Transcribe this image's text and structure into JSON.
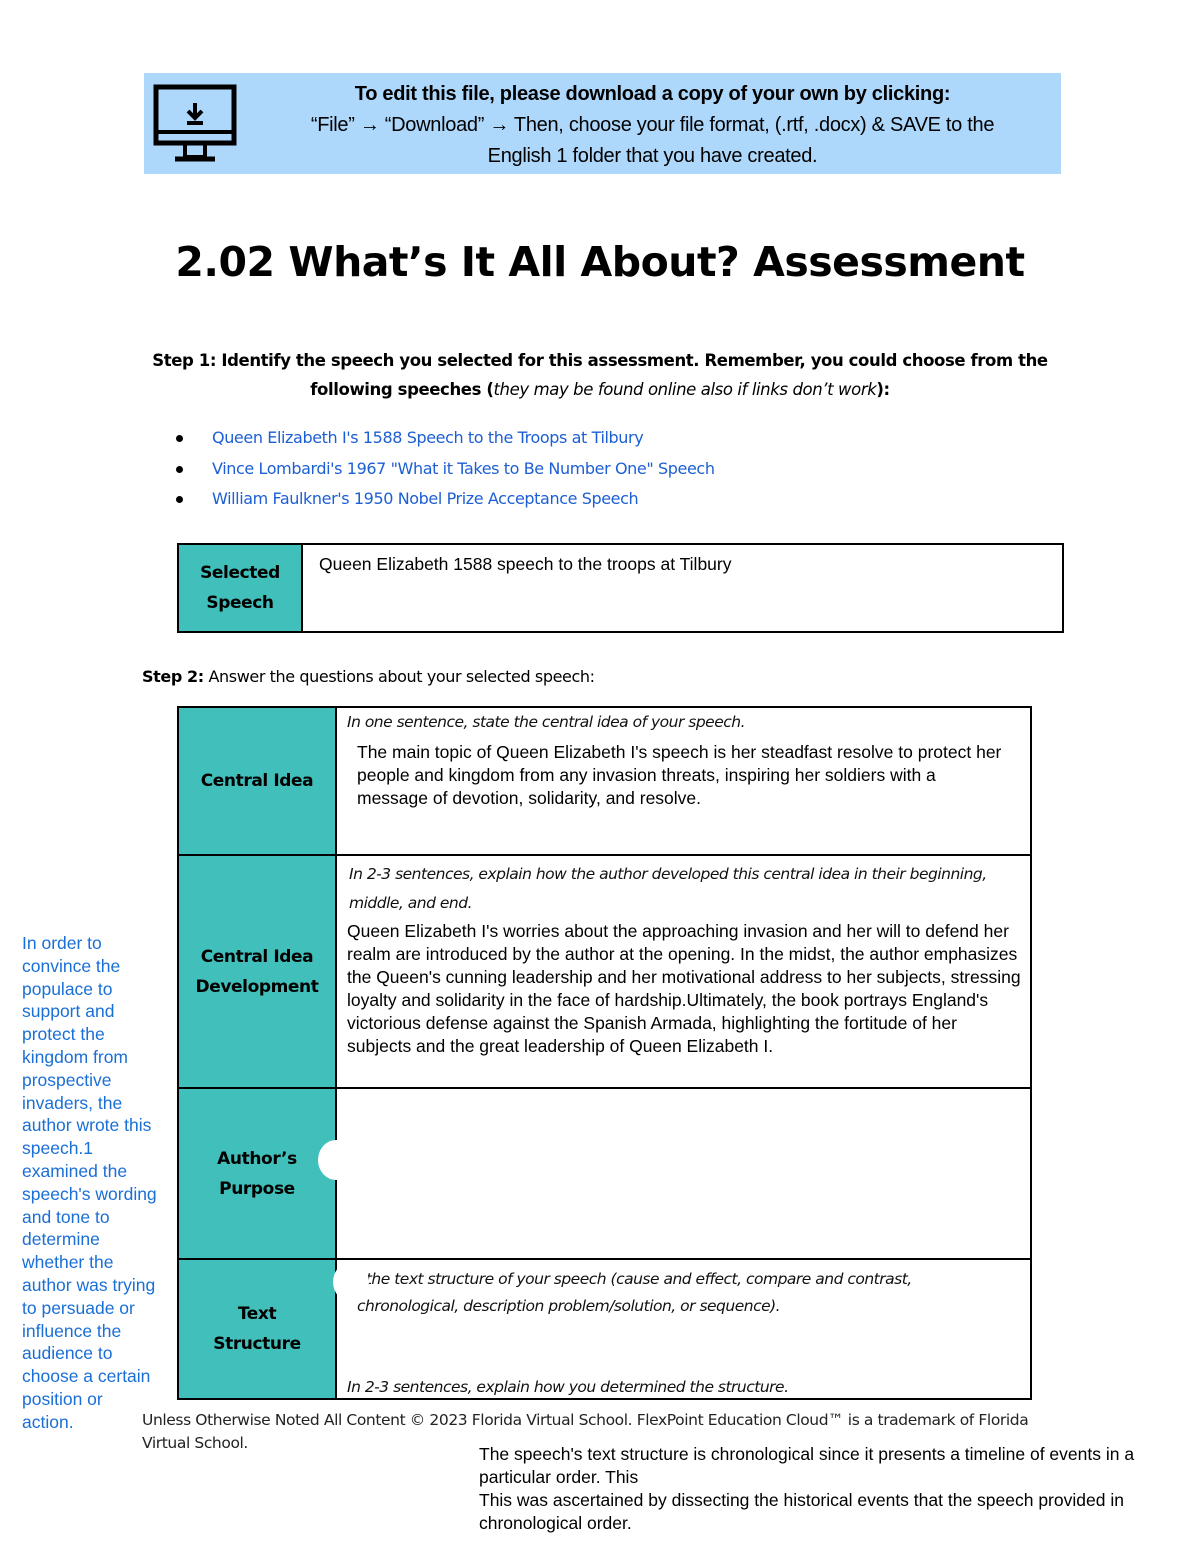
{
  "banner": {
    "icon": "desktop-download-icon",
    "line1": "To edit this file, please download a copy of your own by clicking:",
    "line2": "“File” → “Download” → Then, choose your file format, (.rtf, .docx) & SAVE to the",
    "line3": "English 1 folder that you have created.",
    "background_color": "#aed8fb"
  },
  "title": "2.02 What’s It All About? Assessment",
  "step1": {
    "label": "Step 1:",
    "text": " Identify the speech you selected for this assessment. Remember, you could choose from the following speeches (",
    "italic": "they may be found online also if links don’t work",
    "tail": "):"
  },
  "speech_links": [
    {
      "label": "Queen Elizabeth I's 1588 Speech to the Troops at Tilbury"
    },
    {
      "label": "Vince Lombardi's 1967 \"What it Takes to Be Number One\" Speech"
    },
    {
      "label": "William Faulkner's 1950 Nobel Prize Acceptance Speech"
    }
  ],
  "selected_speech": {
    "label_line1": "Selected",
    "label_line2": "Speech",
    "value": "Queen Elizabeth 1588 speech to the troops at Tilbury"
  },
  "step2": {
    "label": "Step 2:",
    "text": " Answer the questions about your selected speech:"
  },
  "table": {
    "header_color": "#41bfbb",
    "rows": [
      {
        "label_line1": "Central Idea",
        "label_line2": "",
        "prompt": "In one sentence, state the central idea of your speech.",
        "answer": "The main topic of Queen Elizabeth I's speech is her steadfast resolve to protect her people and kingdom from any invasion threats, inspiring her soldiers with a message of devotion, solidarity, and resolve."
      },
      {
        "label_line1": "Central Idea",
        "label_line2": "Development",
        "prompt": "In 2-3 sentences, explain how the author developed this central idea in their beginning, middle, and end.",
        "answer": "Queen Elizabeth I's worries about the approaching invasion and her will to defend her realm are introduced by the author at the opening. In the midst, the author emphasizes the Queen's cunning leadership and her motivational address to her subjects, stressing loyalty and solidarity in the face of hardship.Ultimately, the book portrays England's victorious defense against the Spanish Armada, highlighting the fortitude of her subjects and the great leadership of Queen Elizabeth I."
      },
      {
        "label_line1": "Author’s",
        "label_line2": "Purpose",
        "prompt": "",
        "answer": ""
      },
      {
        "label_line1": "Text",
        "label_line2": "Structure",
        "prompt": ", the text structure of your speech (cause and effect, compare and contrast, chronological, description problem/solution, or sequence).",
        "prompt2": "In 2-3 sentences, explain how you determined the structure.",
        "answer": ""
      }
    ]
  },
  "side_note": "In order to convince the populace to support and protect the kingdom from prospective invaders, the author wrote this speech.1 examined the speech's wording and tone to determine whether the author was trying to persuade or influence the audience to choose a certain position or action.",
  "footer": "Unless Otherwise Noted All Content © 2023 Florida Virtual School. FlexPoint Education Cloud™ is a trademark of Florida Virtual School.",
  "bottom_answer": {
    "line1": "The speech's text structure is chronological since it presents a timeline of events in a particular order. This",
    "line2": "This was ascertained by dissecting the historical events that the speech provided in chronological order."
  },
  "link_color": "#1c5fd4",
  "side_note_color": "#1a6fd6"
}
